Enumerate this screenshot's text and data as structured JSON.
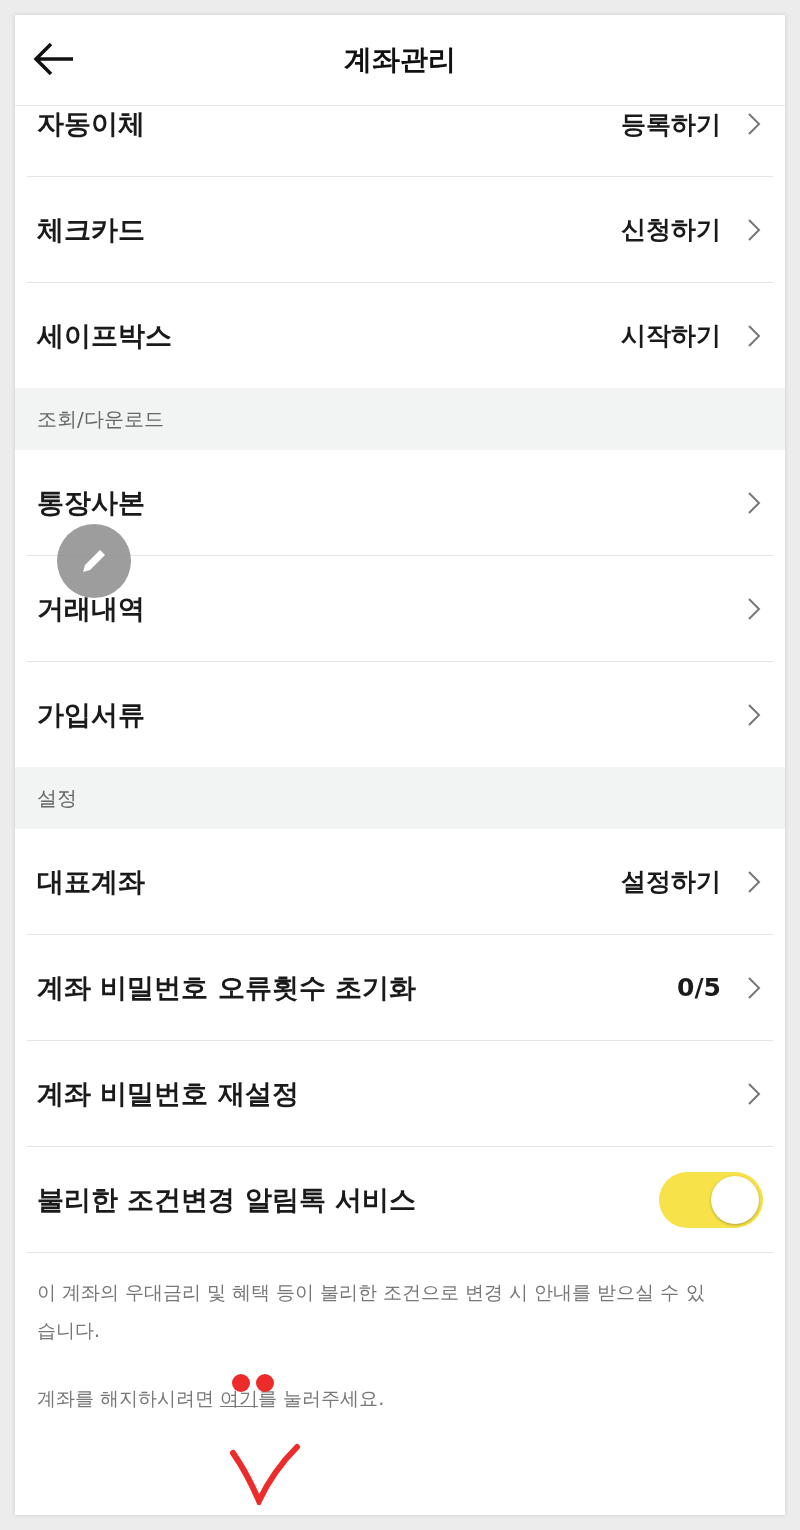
{
  "header": {
    "title": "계좌관리"
  },
  "sections": [
    {
      "rows": [
        {
          "kind": "link",
          "label": "자동이체",
          "value": "등록하기"
        },
        {
          "kind": "link",
          "label": "체크카드",
          "value": "신청하기"
        },
        {
          "kind": "link",
          "label": "세이프박스",
          "value": "시작하기"
        }
      ]
    },
    {
      "title": "조회/다운로드",
      "rows": [
        {
          "kind": "link",
          "label": "통장사본"
        },
        {
          "kind": "link",
          "label": "거래내역"
        },
        {
          "kind": "link",
          "label": "가입서류"
        }
      ]
    },
    {
      "title": "설정",
      "rows": [
        {
          "kind": "link",
          "label": "대표계좌",
          "value": "설정하기"
        },
        {
          "kind": "link",
          "label": "계좌 비밀번호 오류횟수 초기화",
          "value": "0/5"
        },
        {
          "kind": "link",
          "label": "계좌 비밀번호 재설정"
        },
        {
          "kind": "toggle",
          "label": "불리한 조건변경 알림톡 서비스",
          "on": true
        }
      ]
    }
  ],
  "notice": "이 계좌의 우대금리 및 혜택 등이 불리한 조건으로 변경 시 안내를 받으실 수 있습니다.",
  "cancel": {
    "before": "계좌를 해지하시려면 ",
    "link": "여기",
    "after": "를 눌러주세요."
  }
}
